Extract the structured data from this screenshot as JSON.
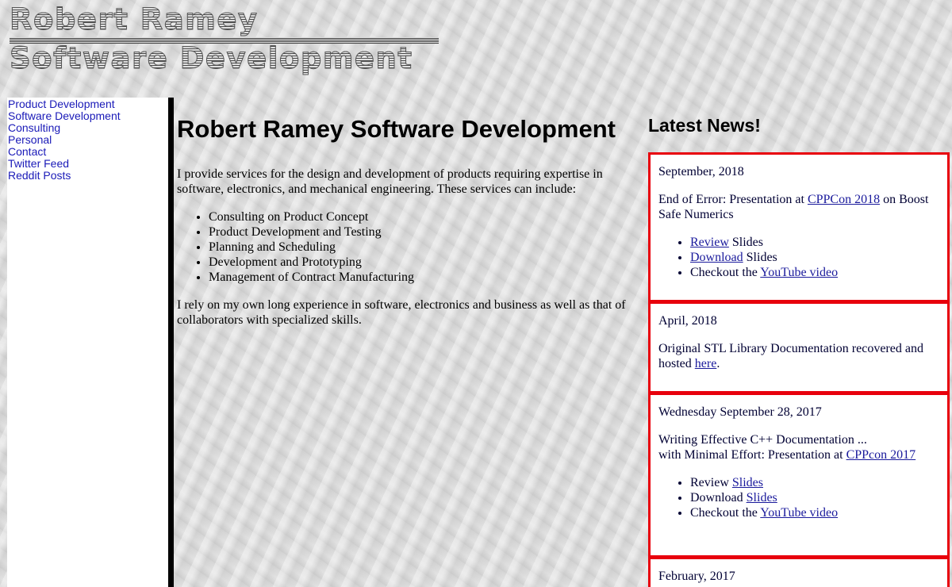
{
  "logo": {
    "line1": "Robert Ramey",
    "line2": "Software Development"
  },
  "sidebar": {
    "items": [
      {
        "label": "Product Development"
      },
      {
        "label": "Software Development"
      },
      {
        "label": "Consulting"
      },
      {
        "label": "Personal"
      },
      {
        "label": "Contact"
      },
      {
        "label": "Twitter Feed"
      },
      {
        "label": "Reddit Posts"
      }
    ]
  },
  "main": {
    "title": "Robert Ramey Software Development",
    "intro": "I provide services for the design and development of products requiring expertise in software, electronics, and mechanical engineering. These services can include:",
    "services": [
      "Consulting on Product Concept",
      "Product Development and Testing",
      "Planning and Scheduling",
      "Development and Prototyping",
      "Management of Contract Manufacturing"
    ],
    "closing": "I rely on my own long experience in software, electronics and business as well as that of collaborators with specialized skills."
  },
  "news": {
    "heading": "Latest News!",
    "items": [
      {
        "date": "September, 2018",
        "text_before": "End of Error: Presentation at ",
        "link": "CPPCon 2018",
        "text_after": " on Boost Safe Numerics",
        "bullets": [
          {
            "link": "Review",
            "text": " Slides"
          },
          {
            "link": "Download",
            "text": " Slides"
          },
          {
            "prefix": "Checkout the ",
            "link": "YouTube video"
          }
        ]
      },
      {
        "date": "April, 2018",
        "text_before": "Original STL Library Documentation recovered and hosted ",
        "link": "here",
        "text_after": "."
      },
      {
        "date": "Wednesday September 28, 2017",
        "text_line1": "Writing Effective C++ Documentation ...",
        "text_before": "with Minimal Effort: Presentation at ",
        "link": "CPPcon 2017",
        "bullets": [
          {
            "prefix": "Review ",
            "link": "Slides"
          },
          {
            "prefix": "Download ",
            "link": "Slides"
          },
          {
            "prefix": "Checkout the ",
            "link": "YouTube video"
          }
        ]
      },
      {
        "date": "February, 2017"
      }
    ]
  },
  "colors": {
    "news_border": "#e8000c",
    "nav_link": "#1a1ab8",
    "news_link": "#1a1a9c",
    "sidebar_border": "#000000"
  }
}
